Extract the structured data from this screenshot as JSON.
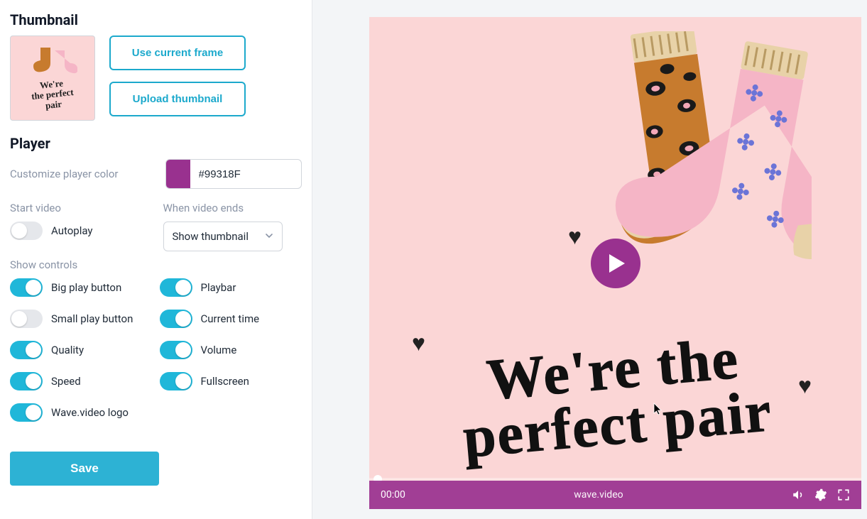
{
  "thumbnail": {
    "section_title": "Thumbnail",
    "preview_text_line1": "We're",
    "preview_text_line2": "the perfect",
    "preview_text_line3": "pair",
    "use_current_frame_label": "Use current frame",
    "upload_thumbnail_label": "Upload thumbnail"
  },
  "player": {
    "section_title": "Player",
    "color_label": "Customize player color",
    "color_value": "#99318F",
    "start_video_label": "Start video",
    "autoplay_label": "Autoplay",
    "autoplay_on": false,
    "when_ends_label": "When video ends",
    "when_ends_value": "Show thumbnail",
    "show_controls_label": "Show controls",
    "controls": {
      "big_play": {
        "label": "Big play button",
        "on": true
      },
      "small_play": {
        "label": "Small play button",
        "on": false
      },
      "quality": {
        "label": "Quality",
        "on": true
      },
      "speed": {
        "label": "Speed",
        "on": true
      },
      "logo": {
        "label": "Wave.video logo",
        "on": true
      },
      "playbar": {
        "label": "Playbar",
        "on": true
      },
      "current_time": {
        "label": "Current time",
        "on": true
      },
      "volume": {
        "label": "Volume",
        "on": true
      },
      "fullscreen": {
        "label": "Fullscreen",
        "on": true
      }
    },
    "save_label": "Save"
  },
  "preview": {
    "headline": "We're the perfect pair",
    "current_time": "00:00",
    "brand": "wave.video"
  },
  "colors": {
    "accent": "#99318F",
    "teal": "#20b7d9"
  }
}
